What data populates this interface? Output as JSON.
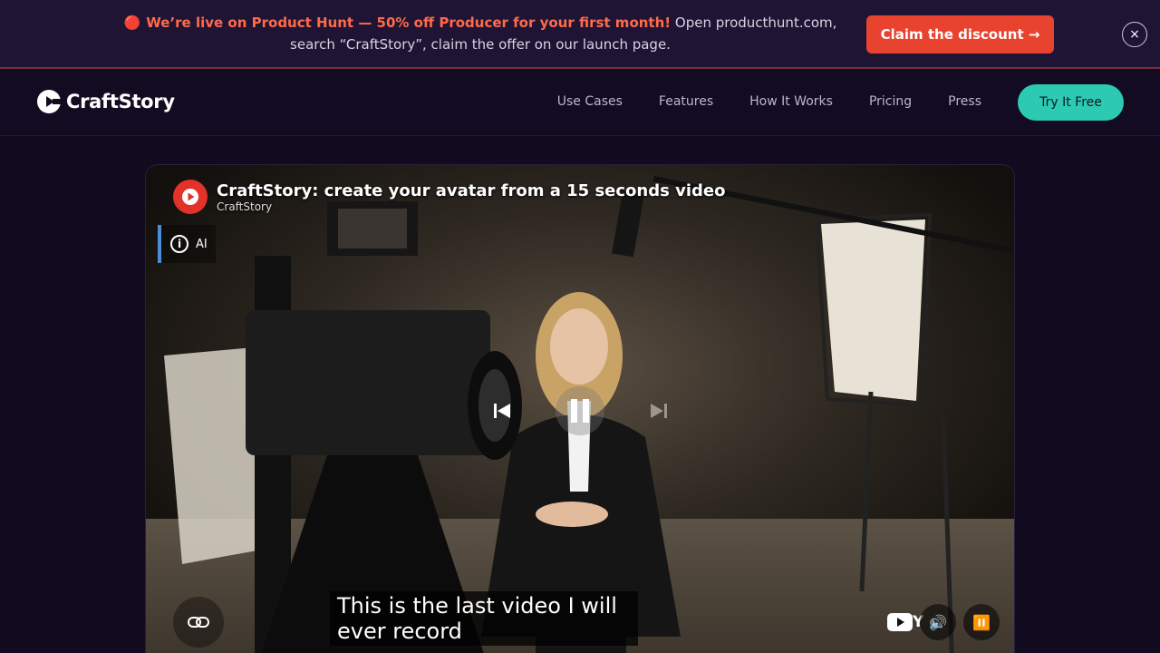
{
  "banner": {
    "dot": "🔴",
    "highlight": "We’re live on Product Hunt — 50% off Producer for your first month!",
    "rest": " Open producthunt.com, search “CraftStory”, claim the offer on our launch page.",
    "cta": "Claim the discount →",
    "close": "×"
  },
  "nav": {
    "brand": "CraftStory",
    "links": [
      "Use Cases",
      "Features",
      "How It Works",
      "Pricing",
      "Press"
    ],
    "cta": "Try It Free"
  },
  "video": {
    "title": "CraftStory: create your avatar from a 15 seconds video",
    "channel": "CraftStory",
    "ai_chip": "AI",
    "caption": "This is the last video I will ever record",
    "youtube_text": "Y e",
    "icons": [
      "info-icon",
      "previous-icon",
      "pause-icon",
      "next-icon",
      "link-icon",
      "youtube-icon",
      "volume-icon",
      "pause-small-icon"
    ]
  },
  "colors": {
    "accent_teal": "#2dcab3",
    "promo_red": "#e8432f",
    "banner_bg": "#1f1433",
    "page_bg": "#120b1f"
  }
}
